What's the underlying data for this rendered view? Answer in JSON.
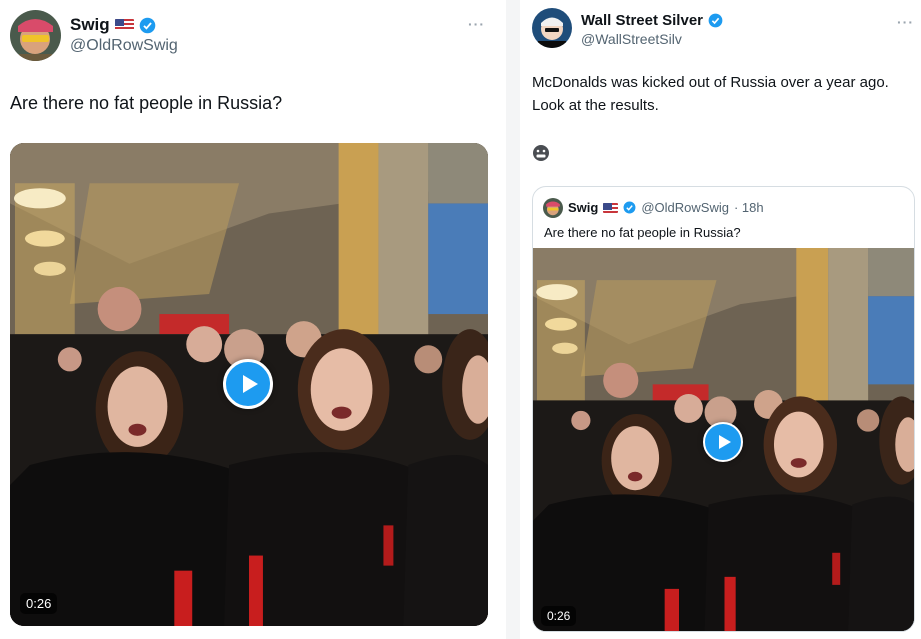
{
  "left_tweet": {
    "display_name": "Swig",
    "handle": "@OldRowSwig",
    "more_label": "···",
    "text": "Are there no fat people in Russia?",
    "video_duration": "0:26"
  },
  "right_tweet": {
    "display_name": "Wall Street Silver",
    "handle": "@WallStreetSilv",
    "more_label": "···",
    "text_line1": "McDonalds was kicked out of Russia over a year ago.",
    "text_line2": "Look at the results.",
    "quoted": {
      "display_name": "Swig",
      "handle": "@OldRowSwig",
      "time": "· 18h",
      "text": "Are there no fat people in Russia?",
      "video_duration": "0:26"
    }
  },
  "colors": {
    "accent": "#1d9bf0",
    "text": "#0f1419",
    "secondary_text": "#536471"
  },
  "icons": {
    "verified": "verified-badge-icon",
    "flag": "us-flag-icon",
    "play": "play-icon",
    "more": "more-options-icon",
    "emoji": "grimacing-emoji-icon"
  }
}
